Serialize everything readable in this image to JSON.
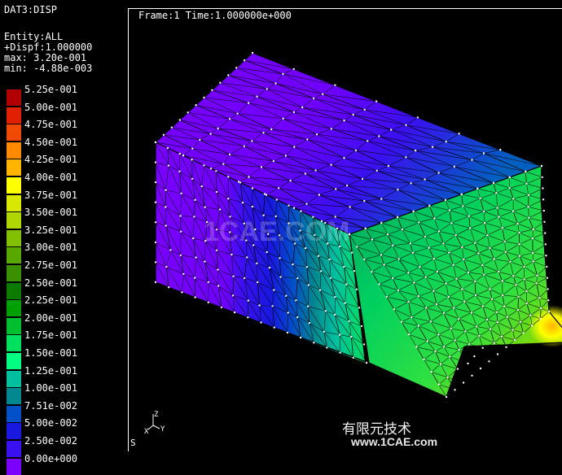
{
  "info": {
    "dataset": "DAT3:DISP",
    "entity": "Entity:ALL",
    "dispf": "+Dispf:1.000000",
    "max": "max: 3.20e-001",
    "min": "min: -4.88e-003"
  },
  "viewport": {
    "frame_title": "Frame:1 Time:1.000000e+000",
    "status": "S",
    "triad": {
      "x": "X",
      "y": "Y",
      "z": "Z"
    }
  },
  "legend": {
    "entries": [
      {
        "label": "5.25e-001",
        "color": "#b00000"
      },
      {
        "label": "5.00e-001",
        "color": "#e02000"
      },
      {
        "label": "4.75e-001",
        "color": "#f04a00"
      },
      {
        "label": "4.50e-001",
        "color": "#ff8a00"
      },
      {
        "label": "4.25e-001",
        "color": "#ffb400"
      },
      {
        "label": "4.00e-001",
        "color": "#ffff00"
      },
      {
        "label": "3.75e-001",
        "color": "#d8e800"
      },
      {
        "label": "3.50e-001",
        "color": "#b0d800"
      },
      {
        "label": "3.25e-001",
        "color": "#80c000"
      },
      {
        "label": "3.00e-001",
        "color": "#58a800"
      },
      {
        "label": "2.75e-001",
        "color": "#3a9000"
      },
      {
        "label": "2.50e-001",
        "color": "#0a7a00"
      },
      {
        "label": "2.25e-001",
        "color": "#00a000"
      },
      {
        "label": "2.00e-001",
        "color": "#00c030"
      },
      {
        "label": "1.75e-001",
        "color": "#00e060"
      },
      {
        "label": "1.50e-001",
        "color": "#00ff80"
      },
      {
        "label": "1.25e-001",
        "color": "#00c0a0"
      },
      {
        "label": "1.00e-001",
        "color": "#008890"
      },
      {
        "label": "7.51e-002",
        "color": "#0050c8"
      },
      {
        "label": "5.00e-002",
        "color": "#1818e0"
      },
      {
        "label": "2.50e-002",
        "color": "#3a10f0"
      },
      {
        "label": "0.00e+000",
        "color": "#7a00ff"
      }
    ]
  },
  "watermark": {
    "center": "1CAE.COM",
    "cn": "有限元技术",
    "url": "www.1CAE.com"
  }
}
